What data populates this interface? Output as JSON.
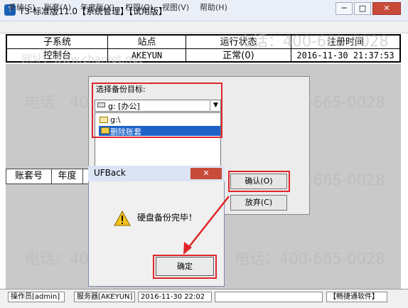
{
  "window": {
    "title": "T3-标准版11.0【系统管理】【试用版】",
    "buttons": {
      "minimize": "─",
      "maximize": "□",
      "close": "✕"
    }
  },
  "menu": [
    "系统(S)",
    "账套(A)",
    "年度账(Y)",
    "权限(O)",
    "视图(V)",
    "帮助(H)"
  ],
  "main_table": {
    "headers": [
      "子系统",
      "站点",
      "运行状态",
      "注册时间"
    ],
    "row": [
      "控制台",
      "AKEYUN",
      "正常(0)",
      "2016-11-30 21:37:53"
    ]
  },
  "account_table": {
    "headers": [
      "账套号",
      "年度"
    ]
  },
  "backup_dialog": {
    "label": "选择备份目标:",
    "drive": "g: [办公]",
    "tree": [
      "g:\\",
      "删除账套"
    ],
    "confirm": "确认(O)",
    "cancel": "放弃(C)"
  },
  "ufback": {
    "title": "UFBack",
    "close": "✕",
    "message": "硬盘备份完毕！",
    "ok": "确定"
  },
  "statusbar": {
    "operator": "操作员[admin]",
    "server": "服务器[AKEYUN]",
    "datetime": "2016-11-30 22:02",
    "brand": "【畅捷通软件】"
  },
  "watermark": {
    "phone": "电话：400-665-0028",
    "site": "网址：www.chanjet.net"
  },
  "colors": {
    "highlight": "#e0252a",
    "selection": "#1e62c8",
    "workspace": "#c9c9c9"
  }
}
